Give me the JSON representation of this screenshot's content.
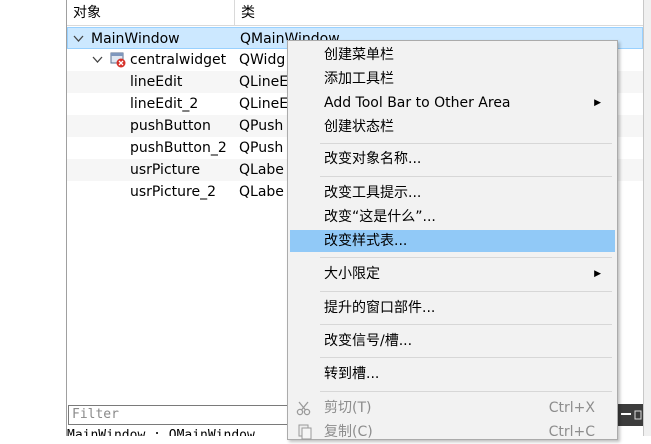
{
  "tree": {
    "header": {
      "col1": "对象",
      "col2": "类"
    },
    "rows": [
      {
        "name": "MainWindow",
        "class": "QMainWindow",
        "expanded": true
      },
      {
        "name": "centralwidget",
        "class": "QWidg",
        "expanded": true,
        "icon": "widget-icon"
      },
      {
        "name": "lineEdit",
        "class": "QLineE"
      },
      {
        "name": "lineEdit_2",
        "class": "QLineE"
      },
      {
        "name": "pushButton",
        "class": "QPush"
      },
      {
        "name": "pushButton_2",
        "class": "QPush"
      },
      {
        "name": "usrPicture",
        "class": "QLabe"
      },
      {
        "name": "usrPicture_2",
        "class": "QLabe"
      }
    ]
  },
  "filter": {
    "placeholder": "Filter"
  },
  "status": {
    "text": "MainWindow : QMainWindow"
  },
  "menu": {
    "items": [
      {
        "label": "创建菜单栏"
      },
      {
        "label": "添加工具栏"
      },
      {
        "label": "Add Tool Bar to Other Area",
        "submenu": true
      },
      {
        "label": "创建状态栏"
      },
      {
        "label": "改变对象名称..."
      },
      {
        "label": "改变工具提示..."
      },
      {
        "label": "改变“这是什么”..."
      },
      {
        "label": "改变样式表...",
        "highlighted": true
      },
      {
        "label": "大小限定",
        "submenu": true
      },
      {
        "label": "提升的窗口部件..."
      },
      {
        "label": "改变信号/槽..."
      },
      {
        "label": "转到槽..."
      },
      {
        "label": "剪切(T)",
        "shortcut": "Ctrl+X",
        "disabled": true,
        "icon": "scissors-icon"
      },
      {
        "label": "复制(C)",
        "shortcut": "Ctrl+C",
        "disabled": true,
        "icon": "copy-icon"
      }
    ]
  },
  "colors": {
    "selection": "#cce8ff",
    "menu_highlight": "#91c9f7",
    "menu_bg": "#f2f2f2"
  }
}
